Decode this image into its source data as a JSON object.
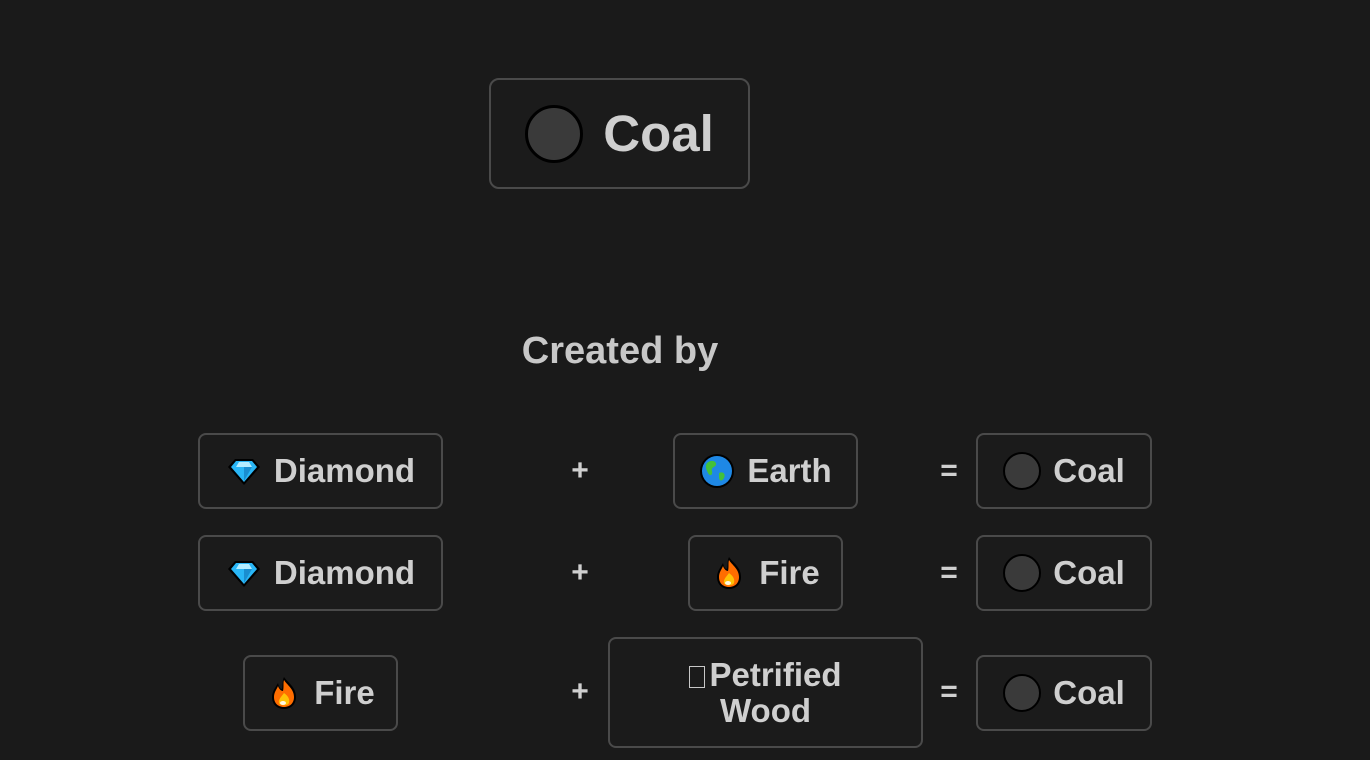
{
  "element": {
    "name": "Coal",
    "icon": "coal-circle-icon"
  },
  "section_heading": "Created by",
  "recipes": [
    {
      "first": {
        "name": "Diamond",
        "icon": "diamond-icon"
      },
      "op": "+",
      "second": {
        "name": "Earth",
        "icon": "globe-icon"
      },
      "eq": "=",
      "result": {
        "name": "Coal",
        "icon": "coal-circle-icon"
      }
    },
    {
      "first": {
        "name": "Diamond",
        "icon": "diamond-icon"
      },
      "op": "+",
      "second": {
        "name": "Fire",
        "icon": "fire-icon"
      },
      "eq": "=",
      "result": {
        "name": "Coal",
        "icon": "coal-circle-icon"
      }
    },
    {
      "first": {
        "name": "Fire",
        "icon": "fire-icon"
      },
      "op": "+",
      "second": {
        "name": "Petrified",
        "name_line2": "Wood",
        "icon": "missing-glyph-icon"
      },
      "eq": "=",
      "result": {
        "name": "Coal",
        "icon": "coal-circle-icon"
      }
    }
  ]
}
